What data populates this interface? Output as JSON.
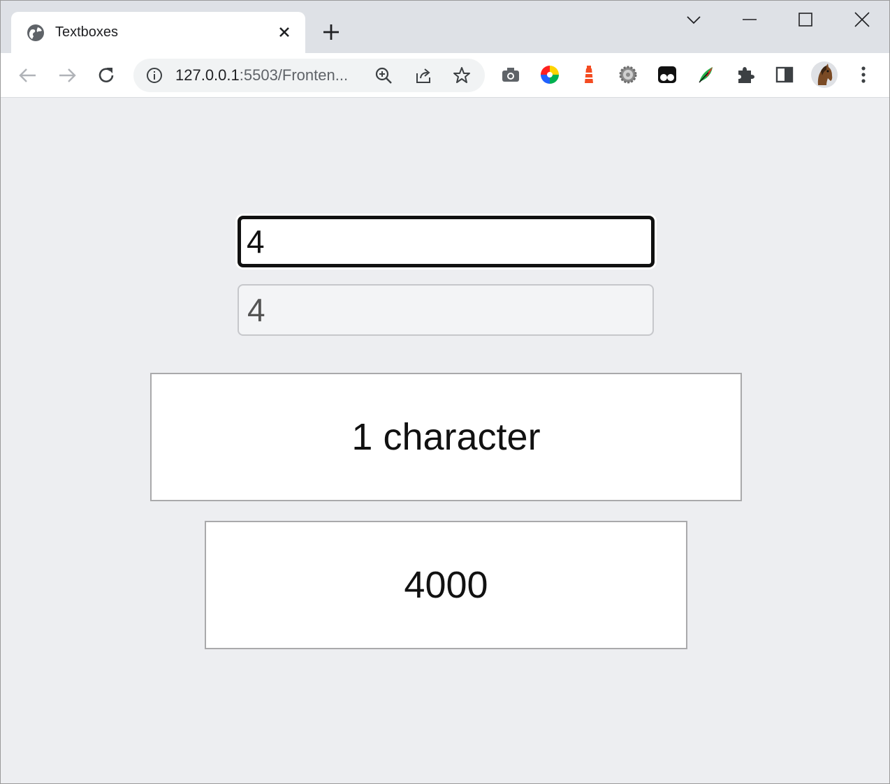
{
  "browser": {
    "tab": {
      "title": "Textboxes"
    },
    "url": {
      "host": "127.0.0.1",
      "rest": ":5503/Fronten..."
    }
  },
  "content": {
    "input_active": {
      "value": "4"
    },
    "input_disabled": {
      "value": "4"
    },
    "length_box": {
      "text": "1 character"
    },
    "number_box": {
      "text": "4000"
    }
  }
}
